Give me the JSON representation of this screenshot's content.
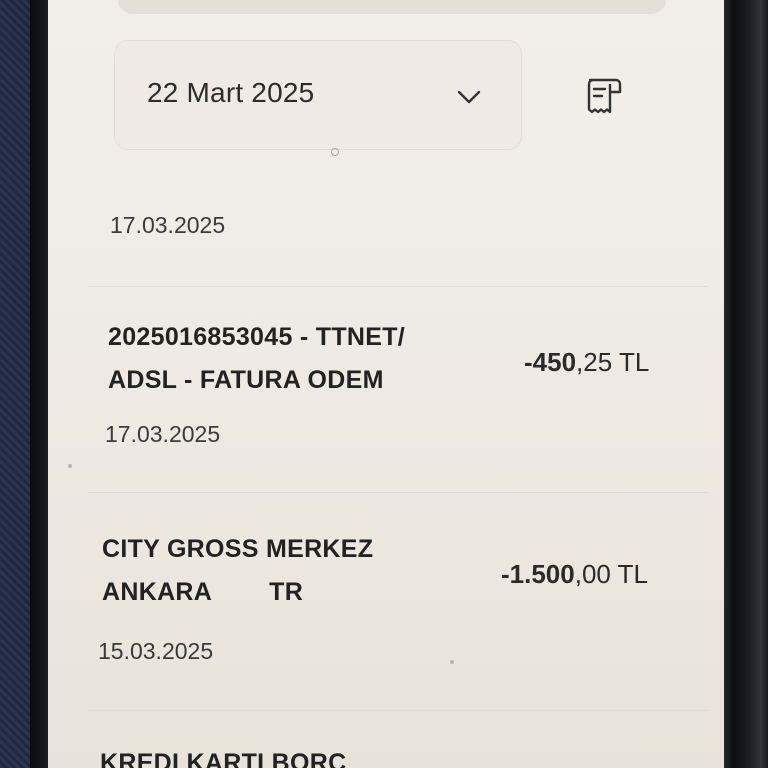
{
  "filter": {
    "selected_date": "22 Mart 2025"
  },
  "icons": {
    "dropdown": "chevron-down-icon",
    "receipt": "receipt-icon"
  },
  "colors": {
    "screen_bg": "#efebe4",
    "text_primary": "#222222",
    "divider": "#e0dcd3"
  },
  "list": {
    "group_date": "17.03.2025",
    "transactions": [
      {
        "title_line1": "2025016853045 - TTNET/",
        "title_line2": "ADSL - FATURA ODEM",
        "amount_integer": "-450",
        "amount_rest": ",25 TL",
        "date": "17.03.2025"
      },
      {
        "title_line1": "CITY GROSS MERKEZ",
        "title_line2": "ANKARA        TR",
        "amount_integer": "-1.500",
        "amount_rest": ",00 TL",
        "date": "15.03.2025"
      },
      {
        "title_line1": "KREDI KARTI BORC"
      }
    ]
  }
}
